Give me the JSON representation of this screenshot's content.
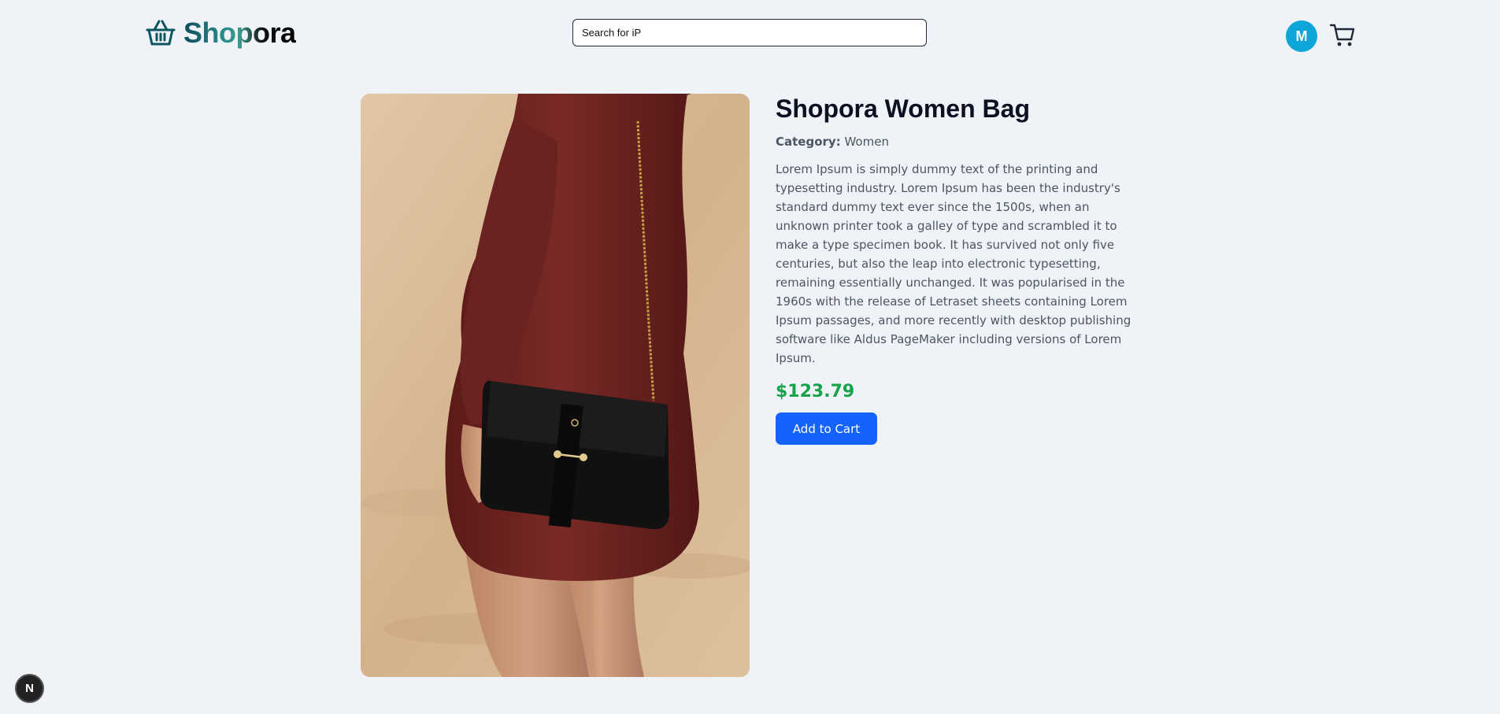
{
  "header": {
    "logo_text": "Shopora",
    "logo_icon": "basket-icon",
    "search_placeholder": "Search for iP",
    "avatar_initial": "M",
    "cart_icon": "cart-icon"
  },
  "product": {
    "image_icon": "product-photo",
    "title": "Shopora Women Bag",
    "category_label": "Category:",
    "category_value": "Women",
    "description": "Lorem Ipsum is simply dummy text of the printing and typesetting industry. Lorem Ipsum has been the industry's standard dummy text ever since the 1500s, when an unknown printer took a galley of type and scrambled it to make a type specimen book. It has survived not only five centuries, but also the leap into electronic typesetting, remaining essentially unchanged. It was popularised in the 1960s with the release of Letraset sheets containing Lorem Ipsum passages, and more recently with desktop publishing software like Aldus PageMaker including versions of Lorem Ipsum.",
    "price": "$123.79",
    "add_to_cart_label": "Add to Cart"
  },
  "dev_badge": {
    "label": "N"
  },
  "colors": {
    "background": "#eff3f8",
    "accent_button": "#1463ff",
    "price": "#16a34a",
    "avatar": "#0ea5d9"
  }
}
